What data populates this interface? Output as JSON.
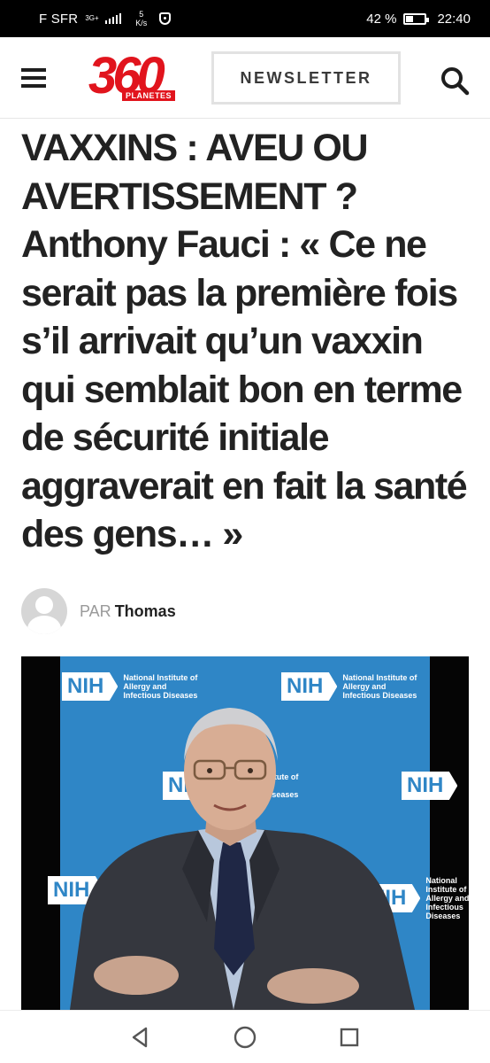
{
  "status_bar": {
    "carrier": "F SFR",
    "network": "3G+",
    "speed_value": "5",
    "speed_unit": "K/s",
    "battery_percent": "42 %",
    "battery_level": 0.42,
    "time": "22:40"
  },
  "header": {
    "logo_number": "360",
    "logo_sub": "PLANETES",
    "newsletter_label": "NEWSLETTER",
    "icons": [
      "menu-icon",
      "search-icon"
    ]
  },
  "article": {
    "title": "VAXXINS : AVEU OU AVERTISSEMENT ? Anthony Fauci : « Ce ne serait pas la première fois s’il arrivait qu’un vaxxin qui semblait bon en terme de sécurité initiale aggraverait en fait la santé des gens… »",
    "by_label": "PAR",
    "author": "Thomas"
  },
  "video": {
    "nih_label": "NIH",
    "institute_text": "National Institute of Allergy and Infectious Diseases"
  },
  "nav": {
    "icons": [
      "back-icon",
      "home-icon",
      "recents-icon"
    ]
  }
}
